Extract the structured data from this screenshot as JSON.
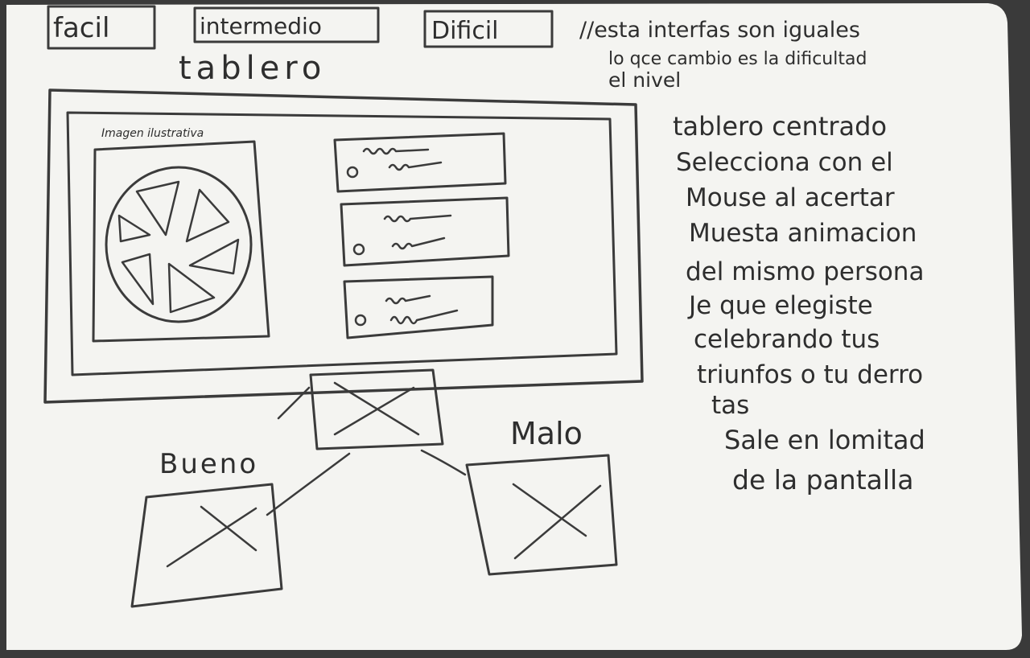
{
  "top_buttons": {
    "easy": "facil",
    "medium": "intermedio",
    "hard": "Dificil"
  },
  "top_note": {
    "line1": "//esta interfas son iguales",
    "line2": "lo qce cambio es la dificultad",
    "line3": "el nivel"
  },
  "board_title": "tablero",
  "panel": {
    "image_label": "Imagen ilustrativa"
  },
  "side_notes": [
    "tablero centrado",
    "Selecciona con el",
    "Mouse al acertar",
    "Muesta animacion",
    "del mismo persona",
    "Je que elegiste",
    "celebrando tus",
    "triunfos o tu derro",
    "tas",
    "Sale en lomitad",
    "de la pantalla"
  ],
  "branch_labels": {
    "good": "Bueno",
    "bad": "Malo"
  },
  "colors": {
    "board": "#f4f4f1",
    "ink": "#2e2e2e",
    "frame": "#3a3a3a"
  }
}
